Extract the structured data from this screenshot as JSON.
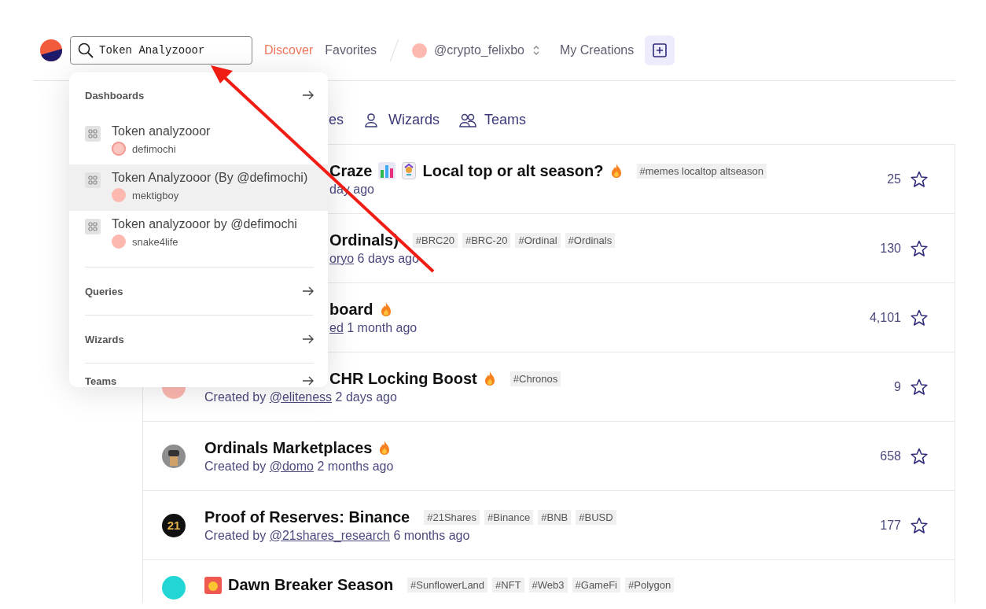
{
  "header": {
    "search": {
      "value": "Token Analyzooor"
    },
    "nav": [
      {
        "label": "Discover",
        "selected": true
      },
      {
        "label": "Favorites",
        "selected": false
      }
    ],
    "user": {
      "handle": "@crypto_felixbo"
    },
    "my_creations": "My Creations"
  },
  "tabs": [
    {
      "label": "es"
    },
    {
      "label": "Wizards"
    },
    {
      "label": "Teams"
    }
  ],
  "rows": [
    {
      "title_cut": true,
      "byline_cut": true,
      "title": [
        {
          "kind": "text",
          "text": "Craze"
        },
        {
          "kind": "chart"
        },
        {
          "kind": "joker"
        },
        {
          "kind": "text",
          "text": "Local top or alt season?"
        },
        {
          "kind": "fire"
        }
      ],
      "tags": [
        "#memes localtop altseason"
      ],
      "byline": {
        "suffix": "day ago"
      },
      "count": "25"
    },
    {
      "title_cut": true,
      "byline_cut": true,
      "title": [
        {
          "kind": "text",
          "text": "Ordinals)"
        }
      ],
      "tags": [
        "#BRC20",
        "#BRC-20",
        "#Ordinal",
        "#Ordinals"
      ],
      "byline": {
        "link": "oryo",
        "suffix": "6 days ago"
      },
      "count": "130"
    },
    {
      "title_cut": true,
      "byline_cut": true,
      "title": [
        {
          "kind": "text",
          "text": "board"
        },
        {
          "kind": "fire"
        }
      ],
      "byline": {
        "link": "ed",
        "suffix": "1 month ago"
      },
      "count": "4,101"
    },
    {
      "title_cut": true,
      "byline_cut": false,
      "avatar": {
        "kind": "dot",
        "color": "#fdb8b0"
      },
      "title": [
        {
          "kind": "text",
          "text": "CHR Locking Boost"
        },
        {
          "kind": "fire"
        }
      ],
      "tags": [
        "#Chronos"
      ],
      "byline": {
        "prefix": "Created by",
        "link": "@eliteness",
        "suffix": "2 days ago"
      },
      "count": "9"
    },
    {
      "title_cut": false,
      "byline_cut": false,
      "avatar": {
        "kind": "pixel"
      },
      "title": [
        {
          "kind": "text",
          "text": "Ordinals Marketplaces"
        },
        {
          "kind": "fire"
        }
      ],
      "byline": {
        "prefix": "Created by",
        "link": "@domo",
        "suffix": "2 months ago"
      },
      "count": "658"
    },
    {
      "title_cut": false,
      "byline_cut": false,
      "avatar": {
        "kind": "logo",
        "text": "21"
      },
      "title": [
        {
          "kind": "text",
          "text": "Proof of Reserves: Binance"
        }
      ],
      "tags": [
        "#21Shares",
        "#Binance",
        "#BNB",
        "#BUSD"
      ],
      "byline": {
        "prefix": "Created by",
        "link": "@21shares_research",
        "suffix": "6 months ago"
      },
      "count": "177"
    },
    {
      "title_cut": false,
      "avatar": {
        "kind": "dot",
        "color": "#22d6d6"
      },
      "title": [
        {
          "kind": "sun"
        },
        {
          "kind": "text",
          "text": "Dawn Breaker Season"
        }
      ],
      "tags": [
        "#SunflowerLand",
        "#NFT",
        "#Web3",
        "#GameFi",
        "#Polygon"
      ]
    }
  ],
  "dropdown": {
    "sections": [
      {
        "title": "Dashboards",
        "results": [
          {
            "title": "Token analyzooor",
            "user": "defimochi",
            "avatar": {
              "kind": "face"
            },
            "selected": false
          },
          {
            "title": "Token Analyzooor (By @defimochi)",
            "user": "mektigboy",
            "avatar": {
              "kind": "dot",
              "color": "#fdb8b0"
            },
            "selected": true
          },
          {
            "title": "Token analyzooor by @defimochi",
            "user": "snake4life",
            "avatar": {
              "kind": "dot",
              "color": "#fdb8b0"
            },
            "selected": false
          }
        ]
      },
      {
        "title": "Queries"
      },
      {
        "title": "Wizards"
      },
      {
        "title": "Teams"
      }
    ]
  }
}
